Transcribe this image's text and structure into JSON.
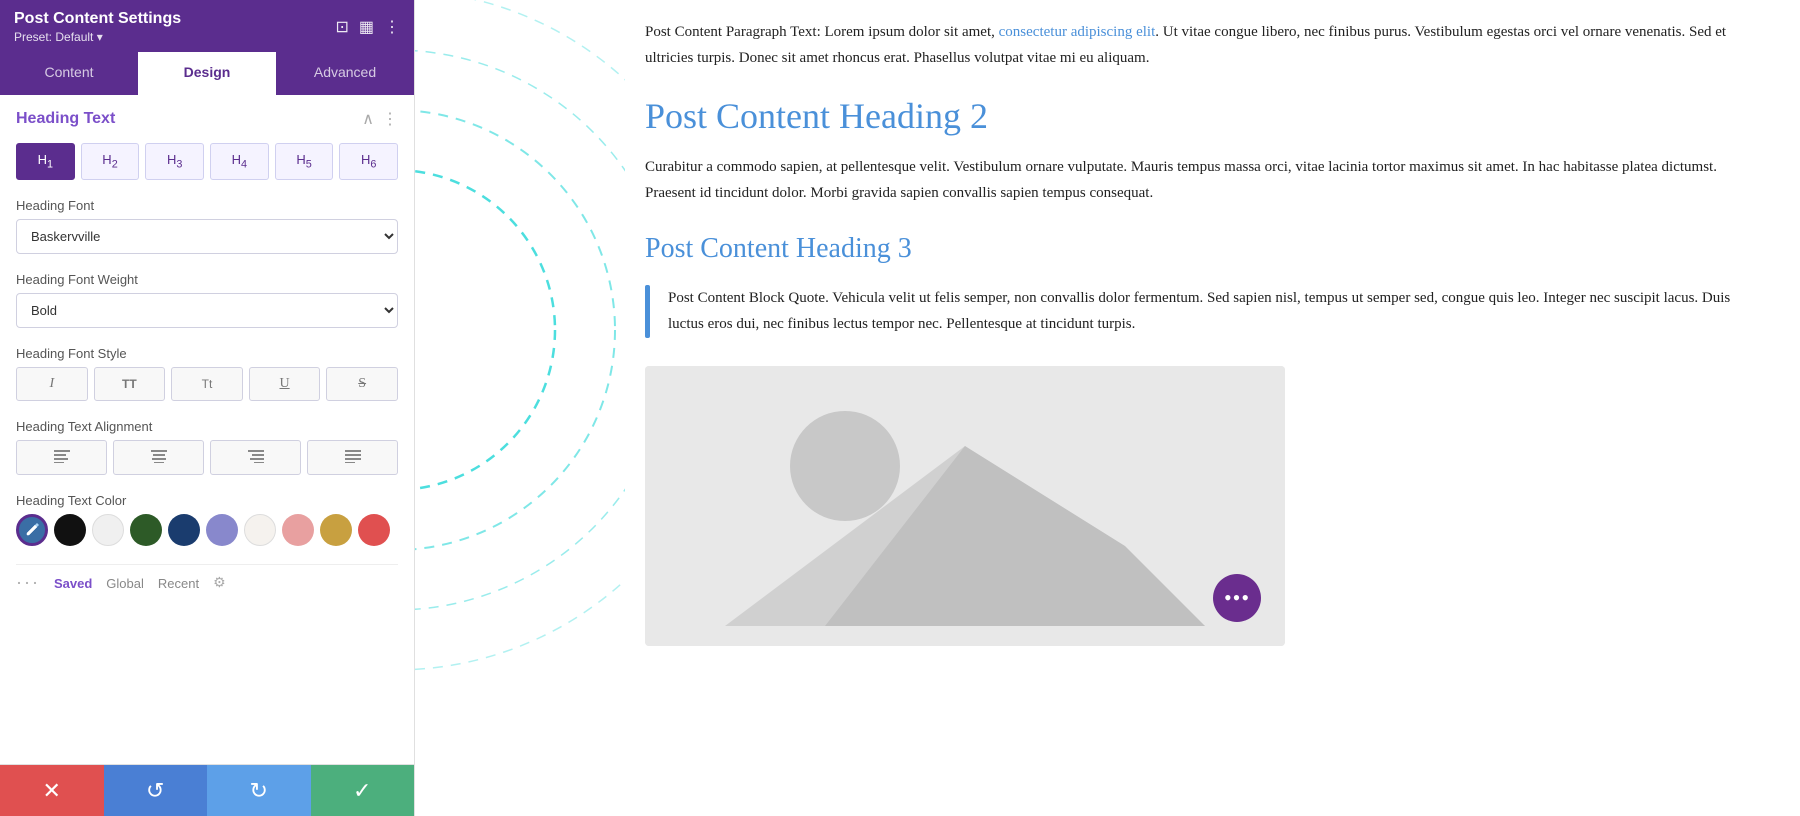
{
  "panel": {
    "title": "Post Content Settings",
    "preset": "Preset: Default ▾",
    "tabs": [
      "Content",
      "Design",
      "Advanced"
    ],
    "active_tab": "Design",
    "section_title": "Heading Text",
    "heading_levels": [
      "H1",
      "H2",
      "H3",
      "H4",
      "H5",
      "H6"
    ],
    "active_heading": "H1",
    "heading_font_label": "Heading Font",
    "heading_font_value": "Baskervville",
    "heading_font_weight_label": "Heading Font Weight",
    "heading_font_weight_value": "Bold",
    "heading_font_style_label": "Heading Font Style",
    "heading_text_alignment_label": "Heading Text Alignment",
    "heading_text_color_label": "Heading Text Color",
    "color_swatches": [
      {
        "color": "#3a6ea5",
        "type": "pencil"
      },
      {
        "color": "#111111"
      },
      {
        "color": "#f0f0f0"
      },
      {
        "color": "#2d5a27"
      },
      {
        "color": "#1a3c6e"
      },
      {
        "color": "#8888cc"
      },
      {
        "color": "#f8f4f0"
      },
      {
        "color": "#e8a0a0"
      },
      {
        "color": "#c8a040"
      },
      {
        "color": "#e05050"
      }
    ],
    "saved_tabs": [
      "Saved",
      "Global",
      "Recent"
    ],
    "active_saved_tab": "Saved"
  },
  "toolbar": {
    "undo_icon": "↺",
    "redo_icon": "↻",
    "close_icon": "✕",
    "check_icon": "✓"
  },
  "content": {
    "intro_link_text": "consectetur adipiscing elit",
    "intro_text_before": "Post Content Paragraph Text: Lorem ipsum dolor sit amet, ",
    "intro_text_after": ". Ut vitae congue libero, nec finibus purus. Vestibulum egestas orci vel ornare venenatis. Sed et ultricies turpis. Donec sit amet rhoncus erat. Phasellus volutpat vitae mi eu aliquam.",
    "heading2": "Post Content Heading 2",
    "para1": "Curabitur a commodo sapien, at pellentesque velit. Vestibulum ornare vulputate. Mauris tempus massa orci, vitae lacinia tortor maximus sit amet. In hac habitasse platea dictumst. Praesent id tincidunt dolor. Morbi gravida sapien convallis sapien tempus consequat.",
    "heading3": "Post Content Heading 3",
    "blockquote": "Post Content Block Quote. Vehicula velit ut felis semper, non convallis dolor fermentum. Sed sapien nisl, tempus ut semper sed, congue quis leo. Integer nec suscipit lacus. Duis luctus eros dui, nec finibus lectus tempor nec. Pellentesque at tincidunt turpis.",
    "image_alt": "Image placeholder",
    "fab_dots": "•••"
  },
  "icons": {
    "minimize": "⊡",
    "layout": "▦",
    "more": "⋮",
    "collapse": "∧",
    "section_more": "⋮",
    "italic": "I",
    "tt_upper": "TT",
    "tt_lower": "Tt",
    "underline": "U",
    "strikethrough": "S",
    "align_left": "≡",
    "align_center": "≡",
    "align_right": "≡",
    "align_justify": "≡",
    "gear": "⚙",
    "dots3": "···"
  }
}
